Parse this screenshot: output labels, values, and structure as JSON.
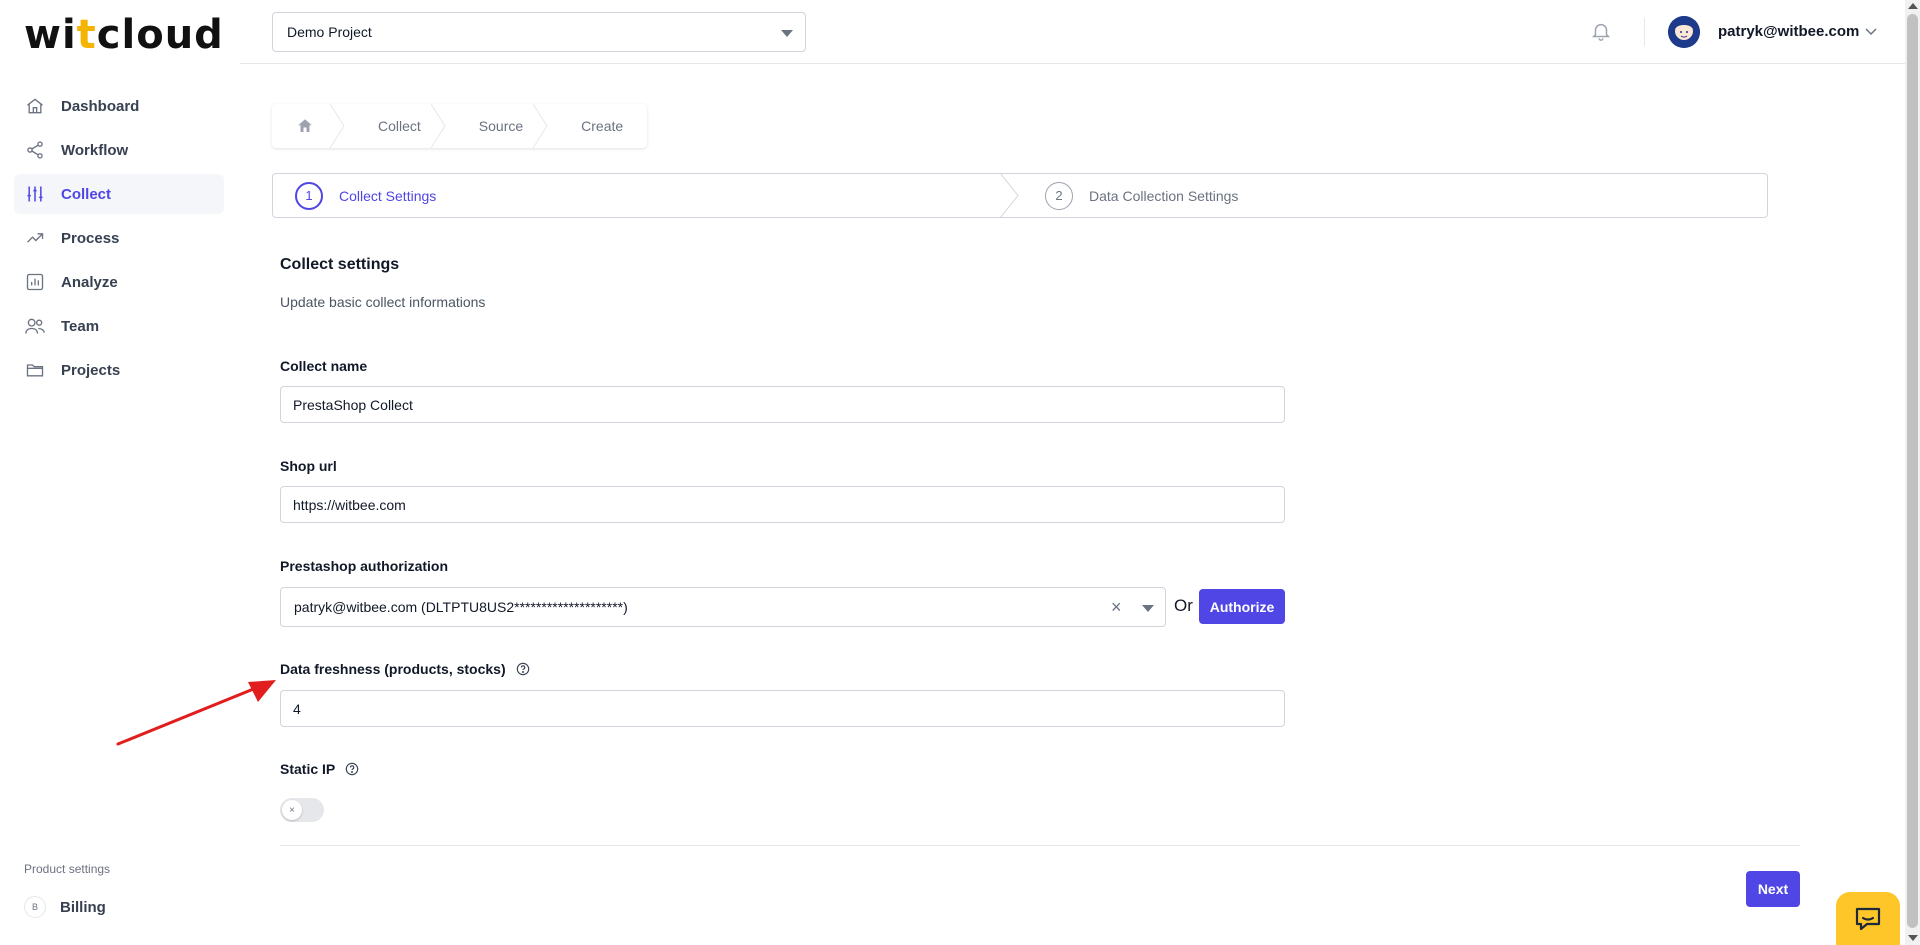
{
  "brand": {
    "logo_pre": "wi",
    "logo_accent": "t",
    "logo_post": "cloud",
    "accent_color": "#4f46e5",
    "logo_accent_color": "#f5b400"
  },
  "sidebar": {
    "items": [
      {
        "label": "Dashboard",
        "icon": "home-icon"
      },
      {
        "label": "Workflow",
        "icon": "share-icon"
      },
      {
        "label": "Collect",
        "icon": "sliders-icon",
        "active": true
      },
      {
        "label": "Process",
        "icon": "trending-icon"
      },
      {
        "label": "Analyze",
        "icon": "bar-chart-icon"
      },
      {
        "label": "Team",
        "icon": "users-icon"
      },
      {
        "label": "Projects",
        "icon": "folder-icon"
      }
    ],
    "product_settings_label": "Product settings",
    "billing_badge": "B",
    "billing_label": "Billing"
  },
  "header": {
    "project_select_value": "Demo Project",
    "user_email": "patryk@witbee.com"
  },
  "breadcrumb": {
    "items": [
      "Collect",
      "Source",
      "Create"
    ]
  },
  "stepper": {
    "steps": [
      {
        "number": "1",
        "label": "Collect Settings",
        "active": true
      },
      {
        "number": "2",
        "label": "Data Collection Settings",
        "active": false
      }
    ]
  },
  "form": {
    "title": "Collect settings",
    "subtitle": "Update basic collect informations",
    "collect_name_label": "Collect name",
    "collect_name_value": "PrestaShop Collect",
    "shop_url_label": "Shop url",
    "shop_url_value": "https://witbee.com",
    "auth_label": "Prestashop authorization",
    "auth_value": "patryk@witbee.com (DLTPTU8US2********************)",
    "or_text": "Or",
    "authorize_label": "Authorize",
    "freshness_label": "Data freshness (products, stocks)",
    "freshness_value": "4",
    "static_ip_label": "Static IP",
    "static_ip_enabled": false,
    "next_label": "Next"
  }
}
